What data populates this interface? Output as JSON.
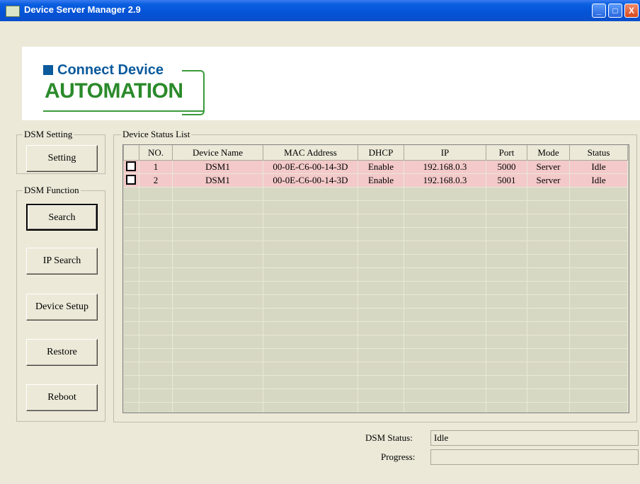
{
  "window": {
    "title": "Device Server Manager 2.9",
    "controls": {
      "minimize": "_",
      "maximize": "□",
      "close": "X"
    }
  },
  "logo": {
    "brand_line": "Connect Device",
    "brand_main": "AUTOMATION",
    "colors": {
      "blue": "#0a5a9c",
      "green": "#2a8a2a"
    }
  },
  "dsm_setting": {
    "label": "DSM Setting",
    "setting_button": "Setting"
  },
  "dsm_function": {
    "label": "DSM Function",
    "buttons": {
      "search": "Search",
      "ip_search": "IP Search",
      "device_setup": "Device Setup",
      "restore": "Restore",
      "reboot": "Reboot"
    }
  },
  "device_list": {
    "label": "Device Status List",
    "columns": [
      "",
      "NO.",
      "Device Name",
      "MAC Address",
      "DHCP",
      "IP",
      "Port",
      "Mode",
      "Status"
    ],
    "rows": [
      {
        "checked": false,
        "no": "1",
        "name": "DSM1",
        "mac": "00-0E-C6-00-14-3D",
        "dhcp": "Enable",
        "ip": "192.168.0.3",
        "port": "5000",
        "mode": "Server",
        "status": "Idle"
      },
      {
        "checked": false,
        "no": "2",
        "name": "DSM1",
        "mac": "00-0E-C6-00-14-3D",
        "dhcp": "Enable",
        "ip": "192.168.0.3",
        "port": "5001",
        "mode": "Server",
        "status": "Idle"
      }
    ],
    "row_highlight_color": "#f3c9c9"
  },
  "status_bar": {
    "dsm_status_label": "DSM Status:",
    "dsm_status_value": "Idle",
    "progress_label": "Progress:",
    "progress_value": ""
  }
}
